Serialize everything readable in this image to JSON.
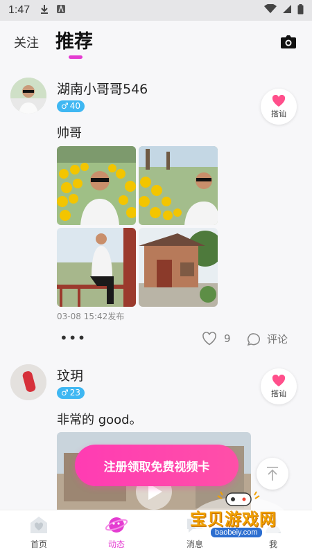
{
  "status_bar": {
    "time": "1:47"
  },
  "top_tabs": {
    "follow": "关注",
    "recommend": "推荐"
  },
  "colors": {
    "accent": "#e43cd1",
    "gender_male": "#3fb7f2",
    "like_pink": "#ff4f8b",
    "banner": "#ff3cb3"
  },
  "posts": [
    {
      "username": "湖南小哥哥546",
      "gender_symbol": "♂",
      "age": "40",
      "caption": "帅哥",
      "chat_label": "搭讪",
      "time": "03-08 15:42发布",
      "likes": "9",
      "comment_label": "评论",
      "more_label": "•••"
    },
    {
      "username": "玟玥",
      "gender_symbol": "♂",
      "age": "23",
      "caption": "非常的 good。",
      "chat_label": "搭讪"
    }
  ],
  "banner": {
    "label": "注册领取免费视频卡"
  },
  "bottom_nav": {
    "items": [
      {
        "label": "首页",
        "icon": "home-heart-icon"
      },
      {
        "label": "动态",
        "icon": "planet-icon"
      },
      {
        "label": "消息",
        "icon": "message-icon"
      },
      {
        "label": "我",
        "icon": "profile-icon"
      }
    ],
    "active_index": 1
  },
  "watermark": {
    "text": "宝贝游戏网",
    "url": "baobeiy.com"
  }
}
